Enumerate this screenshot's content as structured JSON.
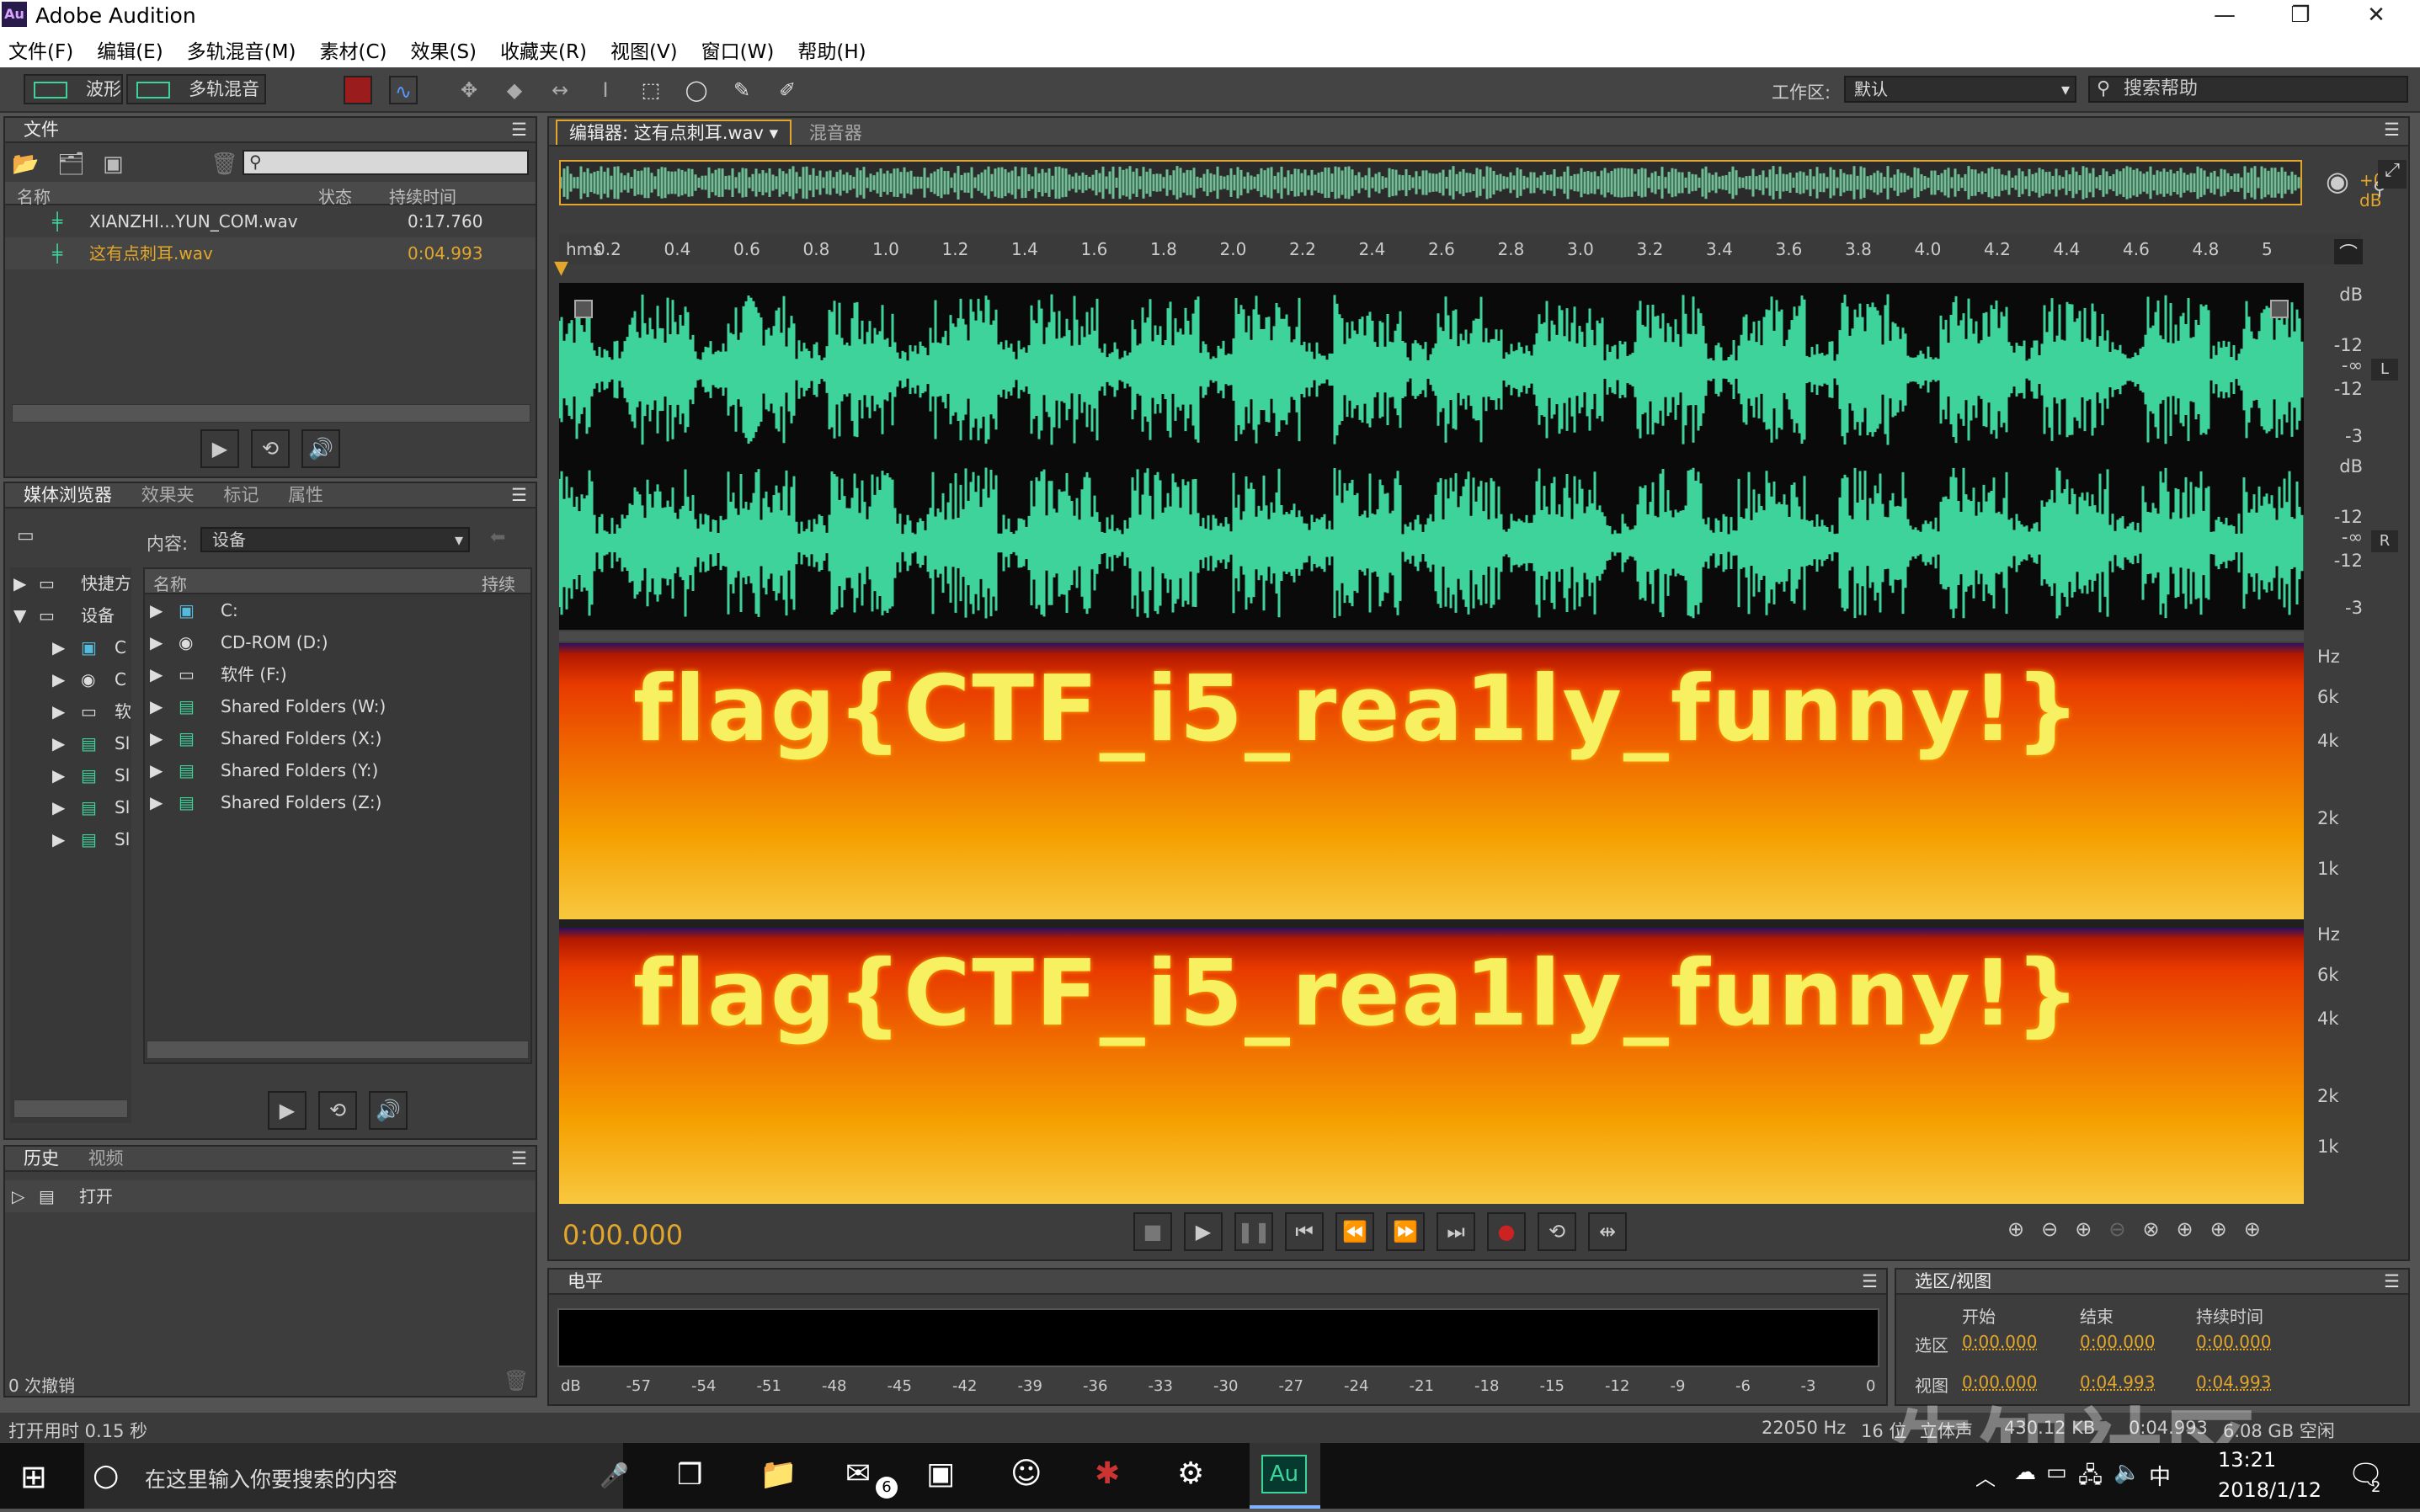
{
  "app": {
    "title": "Adobe Audition",
    "logo": "Au"
  },
  "window_controls": {
    "minimize": "—",
    "maximize": "❐",
    "close": "✕"
  },
  "menu": [
    "文件(F)",
    "编辑(E)",
    "多轨混音(M)",
    "素材(C)",
    "效果(S)",
    "收藏夹(R)",
    "视图(V)",
    "窗口(W)",
    "帮助(H)"
  ],
  "toolbar": {
    "waveform_label": "波形",
    "multitrack_label": "多轨混音",
    "workspace_label": "工作区:",
    "workspace_value": "默认",
    "help_search_placeholder": "搜索帮助"
  },
  "files_panel": {
    "title": "文件",
    "columns": [
      "名称",
      "状态",
      "持续时间"
    ],
    "files": [
      {
        "name": "XIANZHI...YUN_COM.wav",
        "duration": "0:17.760"
      },
      {
        "name": "这有点刺耳.wav",
        "duration": "0:04.993"
      }
    ]
  },
  "media_panel": {
    "tabs": [
      "媒体浏览器",
      "效果夹",
      "标记",
      "属性"
    ],
    "content_label": "内容:",
    "content_value": "设备",
    "left_tree": [
      "快捷方",
      "设备"
    ],
    "left_sub": [
      "C",
      "C",
      "软",
      "Sl",
      "Sl",
      "Sl",
      "Sl"
    ],
    "columns": [
      "名称",
      "持续"
    ],
    "items": [
      "C:",
      "CD-ROM (D:)",
      "软件 (F:)",
      "Shared Folders (W:)",
      "Shared Folders (X:)",
      "Shared Folders (Y:)",
      "Shared Folders (Z:)"
    ]
  },
  "history_panel": {
    "tabs": [
      "历史",
      "视频"
    ],
    "items": [
      "打开"
    ],
    "undo_count": "0 次撤销"
  },
  "editor": {
    "tab_label": "编辑器: 这有点刺耳.wav",
    "mixer_tab": "混音器",
    "gain": "+0 dB",
    "ruler_unit": "hms",
    "ruler_ticks": [
      "0.2",
      "0.4",
      "0.6",
      "0.8",
      "1.0",
      "1.2",
      "1.4",
      "1.6",
      "1.8",
      "2.0",
      "2.2",
      "2.4",
      "2.6",
      "2.8",
      "3.0",
      "3.2",
      "3.4",
      "3.6",
      "3.8",
      "4.0",
      "4.2",
      "4.4",
      "4.6",
      "4.8",
      "5"
    ],
    "wave_scale": [
      "dB",
      "-12",
      "-∞",
      "-12",
      "-3"
    ],
    "channel_left": "L",
    "channel_right": "R",
    "spec_scale": [
      "Hz",
      "6k",
      "4k",
      "2k",
      "1k"
    ],
    "spectrogram_text": "flag{CTF_i5_rea1ly_funny!}",
    "current_time": "0:00.000"
  },
  "level_meter": {
    "title": "电平",
    "scale": [
      "dB",
      "-57",
      "-54",
      "-51",
      "-48",
      "-45",
      "-42",
      "-39",
      "-36",
      "-33",
      "-30",
      "-27",
      "-24",
      "-21",
      "-18",
      "-15",
      "-12",
      "-9",
      "-6",
      "-3",
      "0"
    ]
  },
  "selection_panel": {
    "title": "选区/视图",
    "columns": [
      "开始",
      "结束",
      "持续时间"
    ],
    "rows": [
      {
        "label": "选区",
        "start": "0:00.000",
        "end": "0:00.000",
        "duration": "0:00.000"
      },
      {
        "label": "视图",
        "start": "0:00.000",
        "end": "0:04.993",
        "duration": "0:04.993"
      }
    ]
  },
  "statusbar": {
    "left": "打开用时 0.15 秒",
    "sample_rate": "22050 Hz",
    "bit_depth": "16 位",
    "channels": "立体声",
    "size": "430.12 KB",
    "duration": "0:04.993",
    "free": "6.08 GB 空闲"
  },
  "watermark": "先知社区",
  "taskbar": {
    "search_placeholder": "在这里输入你要搜索的内容",
    "time": "13:21",
    "date": "2018/1/12",
    "ime": "中",
    "mail_badge": "6",
    "notif_badge": "2",
    "au_label": "Au"
  },
  "colors": {
    "waveform": "#3fd39c",
    "accent": "#e2a62a",
    "panel": "#3d3d3d"
  }
}
